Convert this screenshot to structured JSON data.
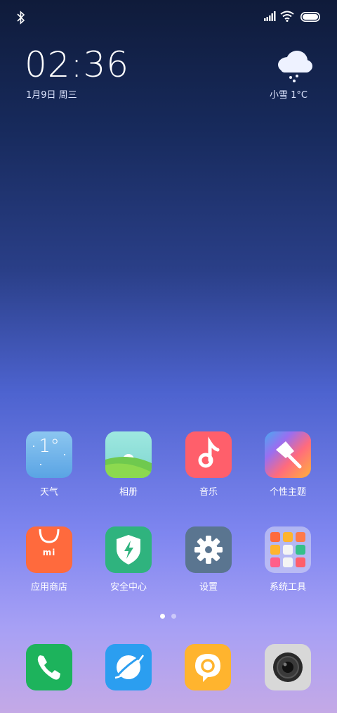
{
  "status_bar": {
    "bluetooth_icon": "bluetooth-icon",
    "signal_icon": "signal-icon",
    "wifi_icon": "wifi-icon",
    "battery_icon": "battery-icon"
  },
  "clock": {
    "time": "02:36",
    "date": "1月9日 周三"
  },
  "weather": {
    "icon": "snow-cloud-icon",
    "text": "小雪  1°C"
  },
  "apps": [
    {
      "label": "天气",
      "icon": "weather-icon",
      "icon_text": "1°",
      "color": "#6fb3ea"
    },
    {
      "label": "相册",
      "icon": "gallery-icon",
      "color": "#7fd3b8"
    },
    {
      "label": "音乐",
      "icon": "music-icon",
      "color": "#ff5f6b"
    },
    {
      "label": "个性主题",
      "icon": "themes-icon",
      "color": "#f6a63a"
    },
    {
      "label": "应用商店",
      "icon": "app-store-icon",
      "icon_text": "mi",
      "color": "#ff6a3d"
    },
    {
      "label": "安全中心",
      "icon": "security-icon",
      "color": "#2fb37e"
    },
    {
      "label": "设置",
      "icon": "settings-icon",
      "color": "#5a7590"
    },
    {
      "label": "系统工具",
      "icon": "folder-icon",
      "color": "#d9d9f0"
    }
  ],
  "page_indicator": {
    "count": 2,
    "active": 1
  },
  "dock": [
    {
      "icon": "phone-icon",
      "color": "#1db35c"
    },
    {
      "icon": "browser-icon",
      "color": "#2b9ef0"
    },
    {
      "icon": "messages-icon",
      "color": "#ffb42e"
    },
    {
      "icon": "camera-icon",
      "color": "#d8d8d8"
    }
  ]
}
